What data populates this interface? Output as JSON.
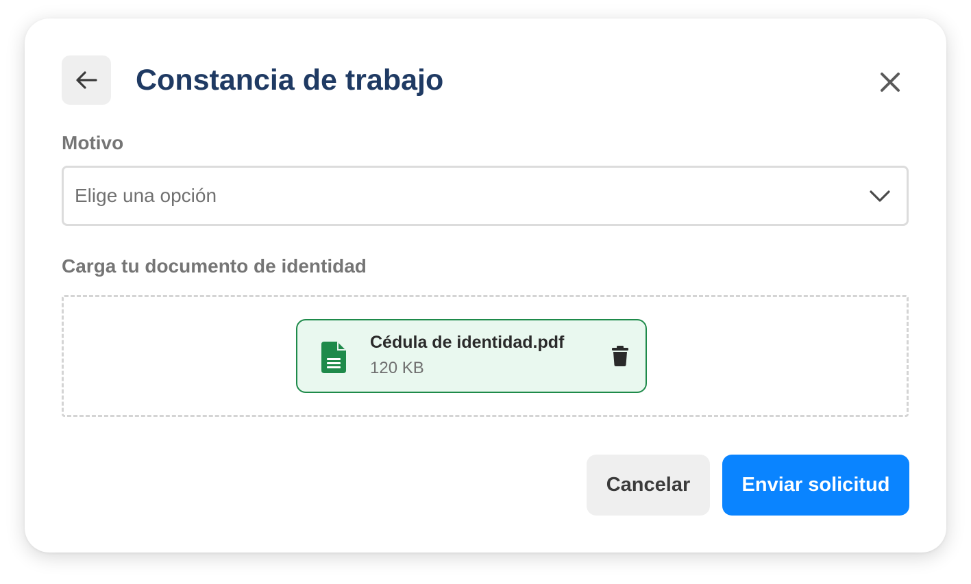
{
  "modal": {
    "title": "Constancia de trabajo",
    "back_icon": "arrow-left-icon",
    "close_icon": "close-icon"
  },
  "motivo": {
    "label": "Motivo",
    "placeholder": "Elige una opción",
    "chevron_icon": "chevron-down-icon"
  },
  "upload": {
    "label": "Carga tu documento de identidad",
    "file": {
      "name": "Cédula de identidad.pdf",
      "size": "120 KB",
      "icon": "document-icon",
      "delete_icon": "trash-icon"
    }
  },
  "actions": {
    "cancel_label": "Cancelar",
    "submit_label": "Enviar solicitud"
  },
  "colors": {
    "title": "#1f3a63",
    "primary": "#0a84ff",
    "file_border": "#1e8a4a",
    "file_bg": "#e9f8ef",
    "file_icon": "#1e8a4a"
  }
}
